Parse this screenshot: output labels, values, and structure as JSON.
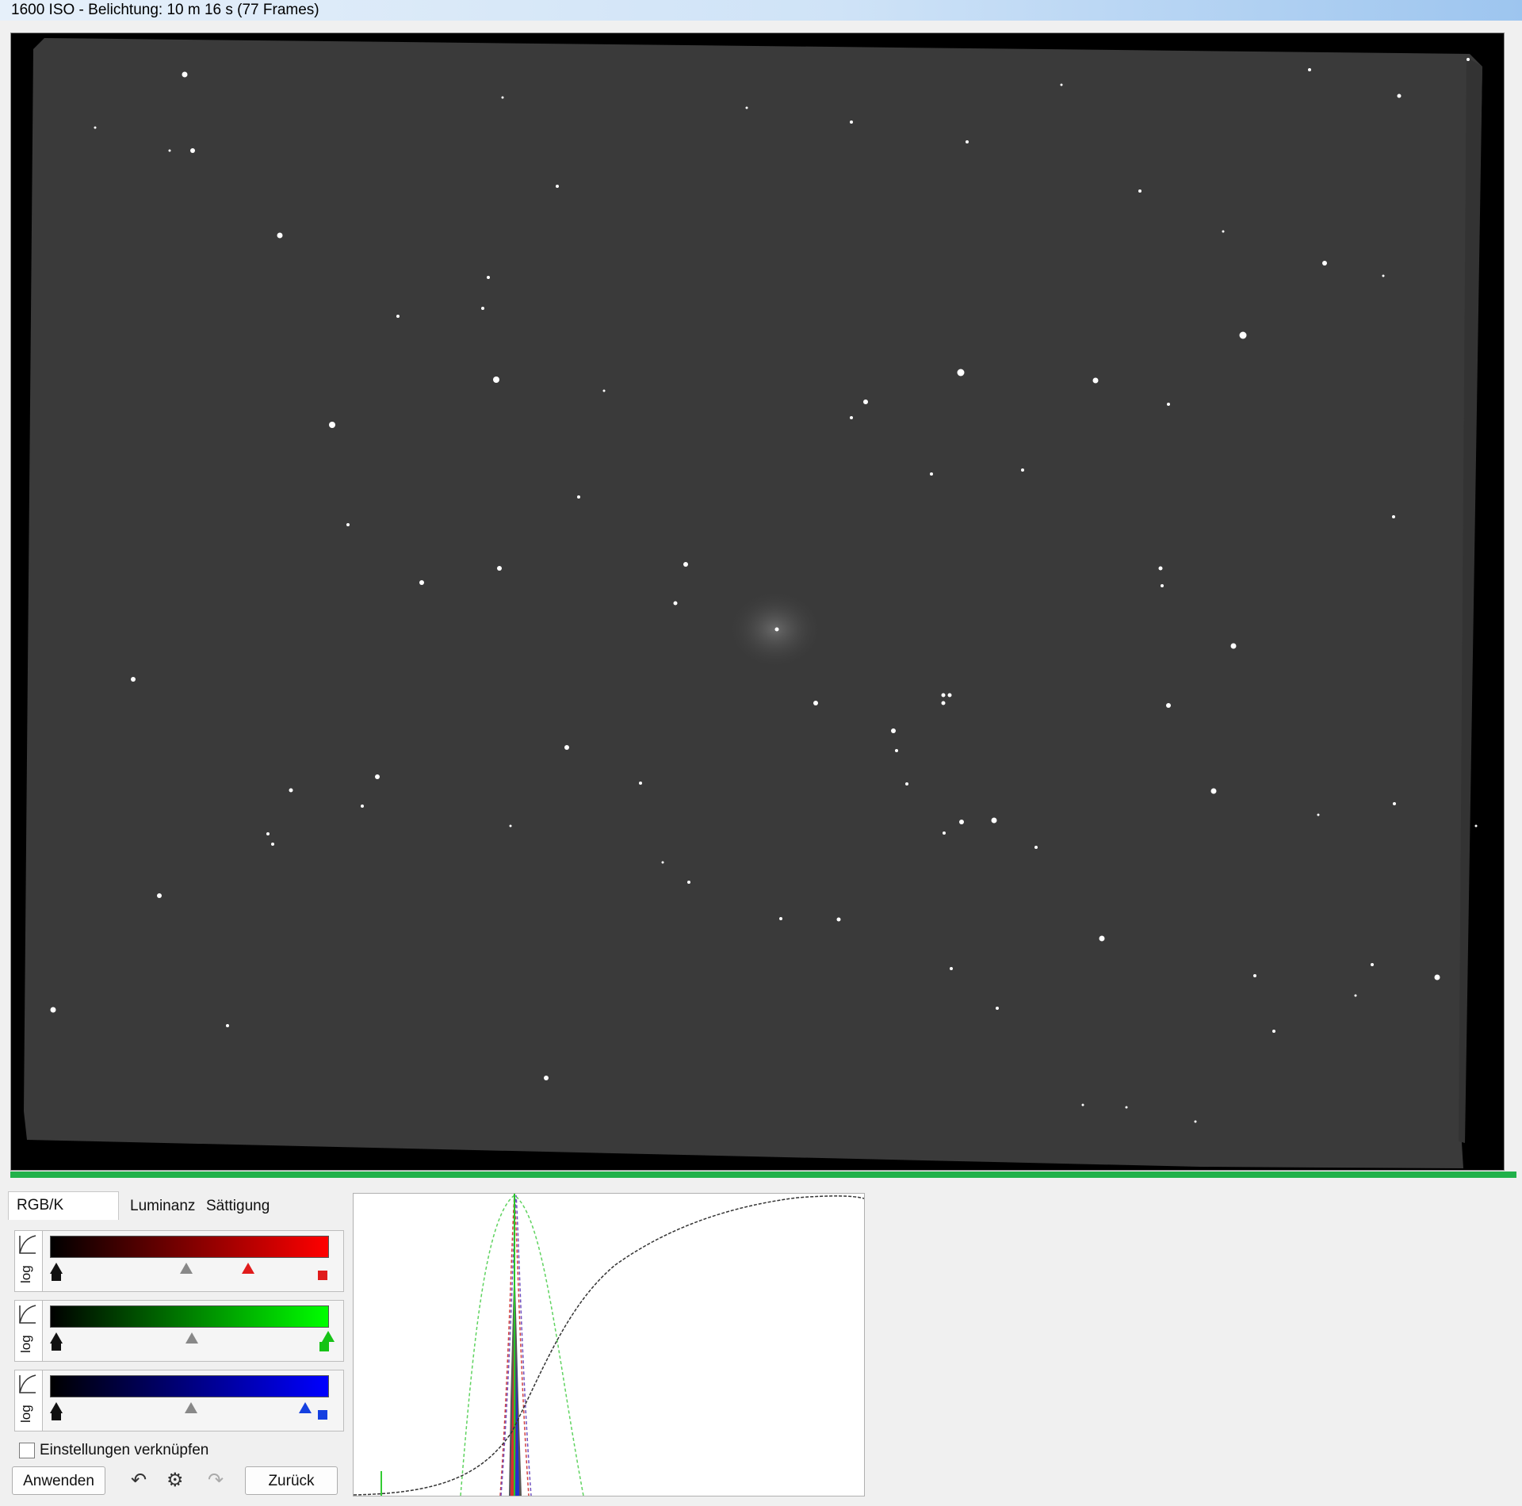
{
  "window": {
    "title_text": "1600 ISO - Belichtung: 10 m 16 s (77 Frames)"
  },
  "tabs": [
    {
      "label": "RGB/K Levels",
      "active": true
    },
    {
      "label": "Luminanz",
      "active": false
    },
    {
      "label": "Sättigung",
      "active": false
    }
  ],
  "channels": [
    {
      "name": "red",
      "color": "#ff0000",
      "log_label": "log"
    },
    {
      "name": "green",
      "color": "#00ff00",
      "log_label": "log"
    },
    {
      "name": "blue",
      "color": "#0000ff",
      "log_label": "log"
    }
  ],
  "link_settings": {
    "label": "Einstellungen verknüpfen",
    "checked": false
  },
  "buttons": {
    "apply": "Anwenden",
    "back": "Zurück"
  },
  "icons": {
    "undo": "undo-icon",
    "settings": "gear-icon",
    "redo": "redo-icon"
  },
  "colors": {
    "accent_green": "#21b14a",
    "sky": "#3a3a3a"
  }
}
